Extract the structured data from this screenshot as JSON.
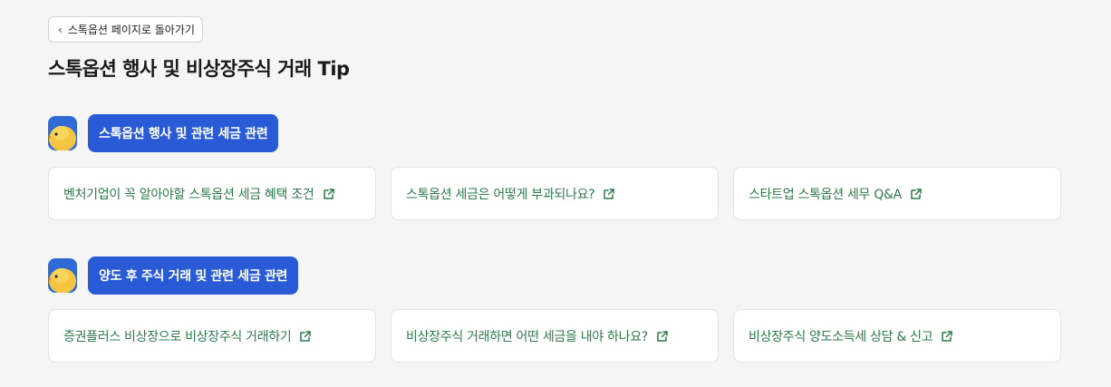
{
  "back": {
    "label": "스톡옵션 페이지로 돌아가기"
  },
  "title": "스톡옵션 행사 및 비상장주식 거래 Tip",
  "colors": {
    "accent": "#2a5bd7",
    "link": "#2c7a4b",
    "background": "#f5f5f5"
  },
  "sections": [
    {
      "heading": "스톡옵션 행사 및 관련 세금 관련",
      "links": [
        {
          "label": "벤처기업이 꼭 알아야할 스톡옵션 세금 혜택 조건",
          "icon": "external-link-icon"
        },
        {
          "label": "스톡옵션 세금은 어떻게 부과되나요?",
          "icon": "external-link-icon"
        },
        {
          "label": "스타트업 스톡옵션 세무 Q&A",
          "icon": "external-link-icon"
        }
      ]
    },
    {
      "heading": "양도 후 주식 거래 및 관련 세금 관련",
      "links": [
        {
          "label": "증권플러스 비상장으로 비상장주식 거래하기",
          "icon": "external-link-icon"
        },
        {
          "label": "비상장주식 거래하면 어떤 세금을 내야 하나요?",
          "icon": "external-link-icon"
        },
        {
          "label": "비상장주식 양도소득세 상담 & 신고",
          "icon": "external-link-icon"
        }
      ]
    }
  ]
}
